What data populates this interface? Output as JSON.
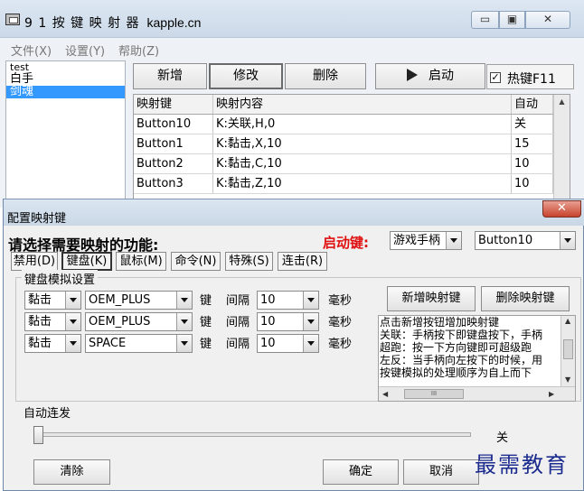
{
  "main_window": {
    "title": "9  1 按 键 映 射 器",
    "site": "kapple.cn",
    "caption_buttons": {
      "minimize": "▭",
      "maximize": "▣",
      "close": "✕"
    },
    "menu": [
      "文件(X)",
      "设置(Y)",
      "帮助(Z)"
    ],
    "profiles": [
      {
        "label": "test",
        "selected": false
      },
      {
        "label": "白手",
        "selected": false
      },
      {
        "label": "剑魂",
        "selected": true
      }
    ],
    "toolbar": {
      "add_label": "新增",
      "edit_label": "修改",
      "delete_label": "删除",
      "start_label": "启动",
      "hotkey_label": "热键F11",
      "hotkey_checked": true
    },
    "table": {
      "headers": [
        "映射键",
        "映射内容",
        "自动"
      ],
      "rows": [
        [
          "Button10",
          "K:关联,H,0",
          "关"
        ],
        [
          "Button1",
          "K:黏击,X,10",
          "15"
        ],
        [
          "Button2",
          "K:黏击,C,10",
          "10"
        ],
        [
          "Button3",
          "K:黏击,Z,10",
          "10"
        ]
      ]
    }
  },
  "dialog": {
    "title": "配置映射键",
    "close_icon": "✕",
    "prompt": "请选择需要映射的功能:",
    "start_key_label": "启动键:",
    "gamepad_value": "游戏手柄",
    "start_key_value": "Button10",
    "tabs": [
      {
        "label": "禁用(D)",
        "active": false
      },
      {
        "label": "键盘(K)",
        "active": true
      },
      {
        "label": "鼠标(M)",
        "active": false
      },
      {
        "label": "命令(N)",
        "active": false
      },
      {
        "label": "特殊(S)",
        "active": false
      },
      {
        "label": "连击(R)",
        "active": false
      }
    ],
    "group_title": "键盘模拟设置",
    "key_label": "键",
    "interval_label": "间隔",
    "ms_label": "毫秒",
    "key_rows": [
      {
        "type": "黏击",
        "key": "OEM_PLUS",
        "interval": "10"
      },
      {
        "type": "黏击",
        "key": "OEM_PLUS",
        "interval": "10"
      },
      {
        "type": "黏击",
        "key": "SPACE",
        "interval": "10"
      }
    ],
    "new_map_label": "新增映射键",
    "delete_map_label": "删除映射键",
    "help_lines": [
      "点击新增按钮增加映射键",
      "关联：手柄按下即键盘按下，手柄",
      "超跑：按一下方向键即可超级跑",
      "左反：当手柄向左按下的时候，用",
      "按键模拟的处理顺序为自上而下"
    ],
    "auto_fire_label": "自动连发",
    "auto_fire_value": "关",
    "auto_fire_level": 0,
    "clear_label": "清除",
    "ok_label": "确定",
    "cancel_label": "取消"
  },
  "watermark": "最需教育"
}
